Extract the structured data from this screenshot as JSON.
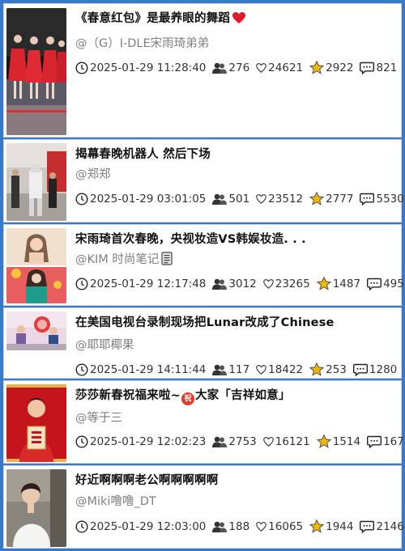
{
  "items": [
    {
      "title": "《春意红包》是最养眼的舞蹈",
      "author": "@（G）I-DLE宋雨琦弟弟",
      "time": "2025-01-29 11:28:40",
      "fans": "276",
      "likes": "24621",
      "favorites": "2922",
      "comments": "821",
      "thumb_desc": "four women in red dresses dancing on stage",
      "title_icon": "heart-icon"
    },
    {
      "title": "揭幕春晚机器人 然后下场",
      "author": "@郑郑",
      "time": "2025-01-29 03:01:05",
      "fans": "501",
      "likes": "23512",
      "favorites": "2777",
      "comments": "5530",
      "thumb_desc": "robots on stage backstage"
    },
    {
      "title": "宋雨琦首次春晚，央视妆造VS韩娱妆造. . .",
      "author": "@KIM 时尚笔记",
      "time": "2025-01-29 12:17:48",
      "fans": "3012",
      "likes": "23265",
      "favorites": "1487",
      "comments": "495",
      "thumb_desc": "singer makeup comparison",
      "author_icon": "notebook-icon"
    },
    {
      "title": "在美国电视台录制现场把Lunar改成了Chinese",
      "author": "@耶耶椰果",
      "time": "2025-01-29 14:11:44",
      "fans": "117",
      "likes": "18422",
      "favorites": "253",
      "comments": "1280",
      "thumb_desc": "TV studio recording"
    },
    {
      "title": "莎莎新春祝福来啦~",
      "title_badge": "祝",
      "title_tail": "大家「吉祥如意」",
      "author": "@等于三",
      "time": "2025-01-29 12:02:23",
      "fans": "2753",
      "likes": "16121",
      "favorites": "1514",
      "comments": "167",
      "thumb_desc": "athlete holding new year greeting"
    },
    {
      "title": "好近啊啊啊老公啊啊啊啊啊",
      "author": "@Miki噜噜_DT",
      "time": "2025-01-29 12:03:00",
      "fans": "188",
      "likes": "16065",
      "favorites": "1944",
      "comments": "2146",
      "thumb_desc": "young man in white shirt"
    }
  ],
  "colors": {
    "background": "#3b78c6",
    "card": "#ffffff",
    "author": "#7f7f7f",
    "star": "#f2b705",
    "heart_red": "#e0192b"
  }
}
